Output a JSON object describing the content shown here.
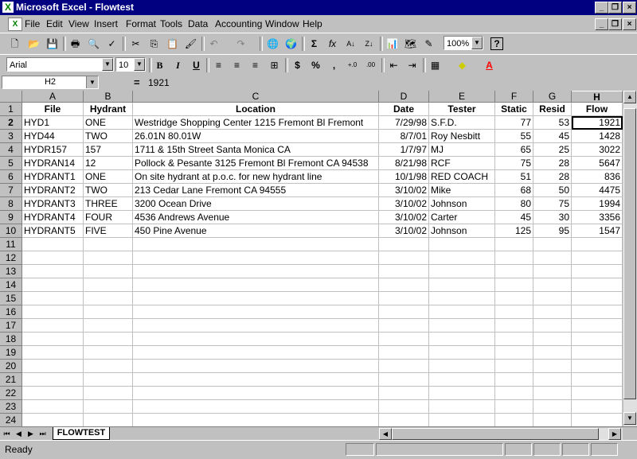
{
  "window": {
    "title": "Microsoft Excel - Flowtest",
    "min": "_",
    "max": "❐",
    "close": "×"
  },
  "menu": [
    "File",
    "Edit",
    "View",
    "Insert",
    "Format",
    "Tools",
    "Data",
    "Accounting",
    "Window",
    "Help"
  ],
  "toolbar": {
    "zoom": "100%",
    "help": "?"
  },
  "format": {
    "font": "Arial",
    "size": "10",
    "bold": "B",
    "italic": "I",
    "underline": "U",
    "currency": "$",
    "percent": "%",
    "comma": ",",
    "inc_dec": "+.0",
    "dec_dec": ".00"
  },
  "formula": {
    "cell": "H2",
    "eq": "=",
    "value": "1921"
  },
  "columns": [
    "A",
    "B",
    "C",
    "D",
    "E",
    "F",
    "G",
    "H"
  ],
  "headers": [
    "File",
    "Hydrant",
    "Location",
    "Date",
    "Tester",
    "Static",
    "Resid",
    "Flow"
  ],
  "rows": [
    [
      "HYD1",
      "ONE",
      "Westridge Shopping Center 1215 Fremont Bl Fremont",
      "7/29/98",
      "S.F.D.",
      "77",
      "53",
      "1921"
    ],
    [
      "HYD44",
      "TWO",
      "26.01N 80.01W",
      "8/7/01",
      "Roy Nesbitt",
      "55",
      "45",
      "1428"
    ],
    [
      "HYDR157",
      "157",
      "1711 & 15th Street Santa Monica CA",
      "1/7/97",
      "MJ",
      "65",
      "25",
      "3022"
    ],
    [
      "HYDRAN14",
      "12",
      "Pollock & Pesante 3125 Fremont Bl Fremont CA 94538",
      "8/21/98",
      "RCF",
      "75",
      "28",
      "5647"
    ],
    [
      "HYDRANT1",
      "ONE",
      "On site hydrant at p.o.c. for new hydrant line",
      "10/1/98",
      "RED COACH",
      "51",
      "28",
      "836"
    ],
    [
      "HYDRANT2",
      "TWO",
      "213 Cedar Lane Fremont CA 94555",
      "3/10/02",
      "Mike",
      "68",
      "50",
      "4475"
    ],
    [
      "HYDRANT3",
      "THREE",
      "3200 Ocean Drive",
      "3/10/02",
      "Johnson",
      "80",
      "75",
      "1994"
    ],
    [
      "HYDRANT4",
      "FOUR",
      "4536 Andrews Avenue",
      "3/10/02",
      "Carter",
      "45",
      "30",
      "3356"
    ],
    [
      "HYDRANT5",
      "FIVE",
      "450 Pine Avenue",
      "3/10/02",
      "Johnson",
      "125",
      "95",
      "1547"
    ]
  ],
  "row_numbers": [
    "1",
    "2",
    "3",
    "4",
    "5",
    "6",
    "7",
    "8",
    "9",
    "10",
    "11",
    "12",
    "13",
    "14",
    "15",
    "16",
    "17",
    "18",
    "19",
    "20",
    "21",
    "22",
    "23",
    "24"
  ],
  "sheet_tab": "FLOWTEST",
  "status": "Ready"
}
